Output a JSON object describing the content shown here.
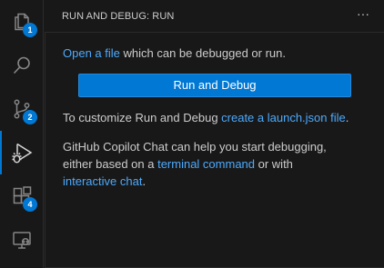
{
  "activity_bar": {
    "explorer_badge": "1",
    "source_control_badge": "2",
    "extensions_badge": "4"
  },
  "sidebar": {
    "title": "RUN AND DEBUG: RUN",
    "more_actions": "···"
  },
  "welcome": {
    "open_file_link": "Open a file",
    "open_file_rest": " which can be debugged or run.",
    "run_button_label": "Run and Debug",
    "customize_prefix": "To customize Run and Debug ",
    "customize_link": "create a launch.json file",
    "customize_suffix": ".",
    "copilot_line1": "GitHub Copilot Chat can help you start debugging,",
    "copilot_line2_prefix": "either based on a ",
    "copilot_terminal_link": "terminal command",
    "copilot_line2_suffix": " or with",
    "copilot_interactive_link": "interactive chat",
    "copilot_line3_suffix": "."
  },
  "colors": {
    "accent": "#0078d4",
    "link": "#4daafc",
    "background": "#181818"
  }
}
